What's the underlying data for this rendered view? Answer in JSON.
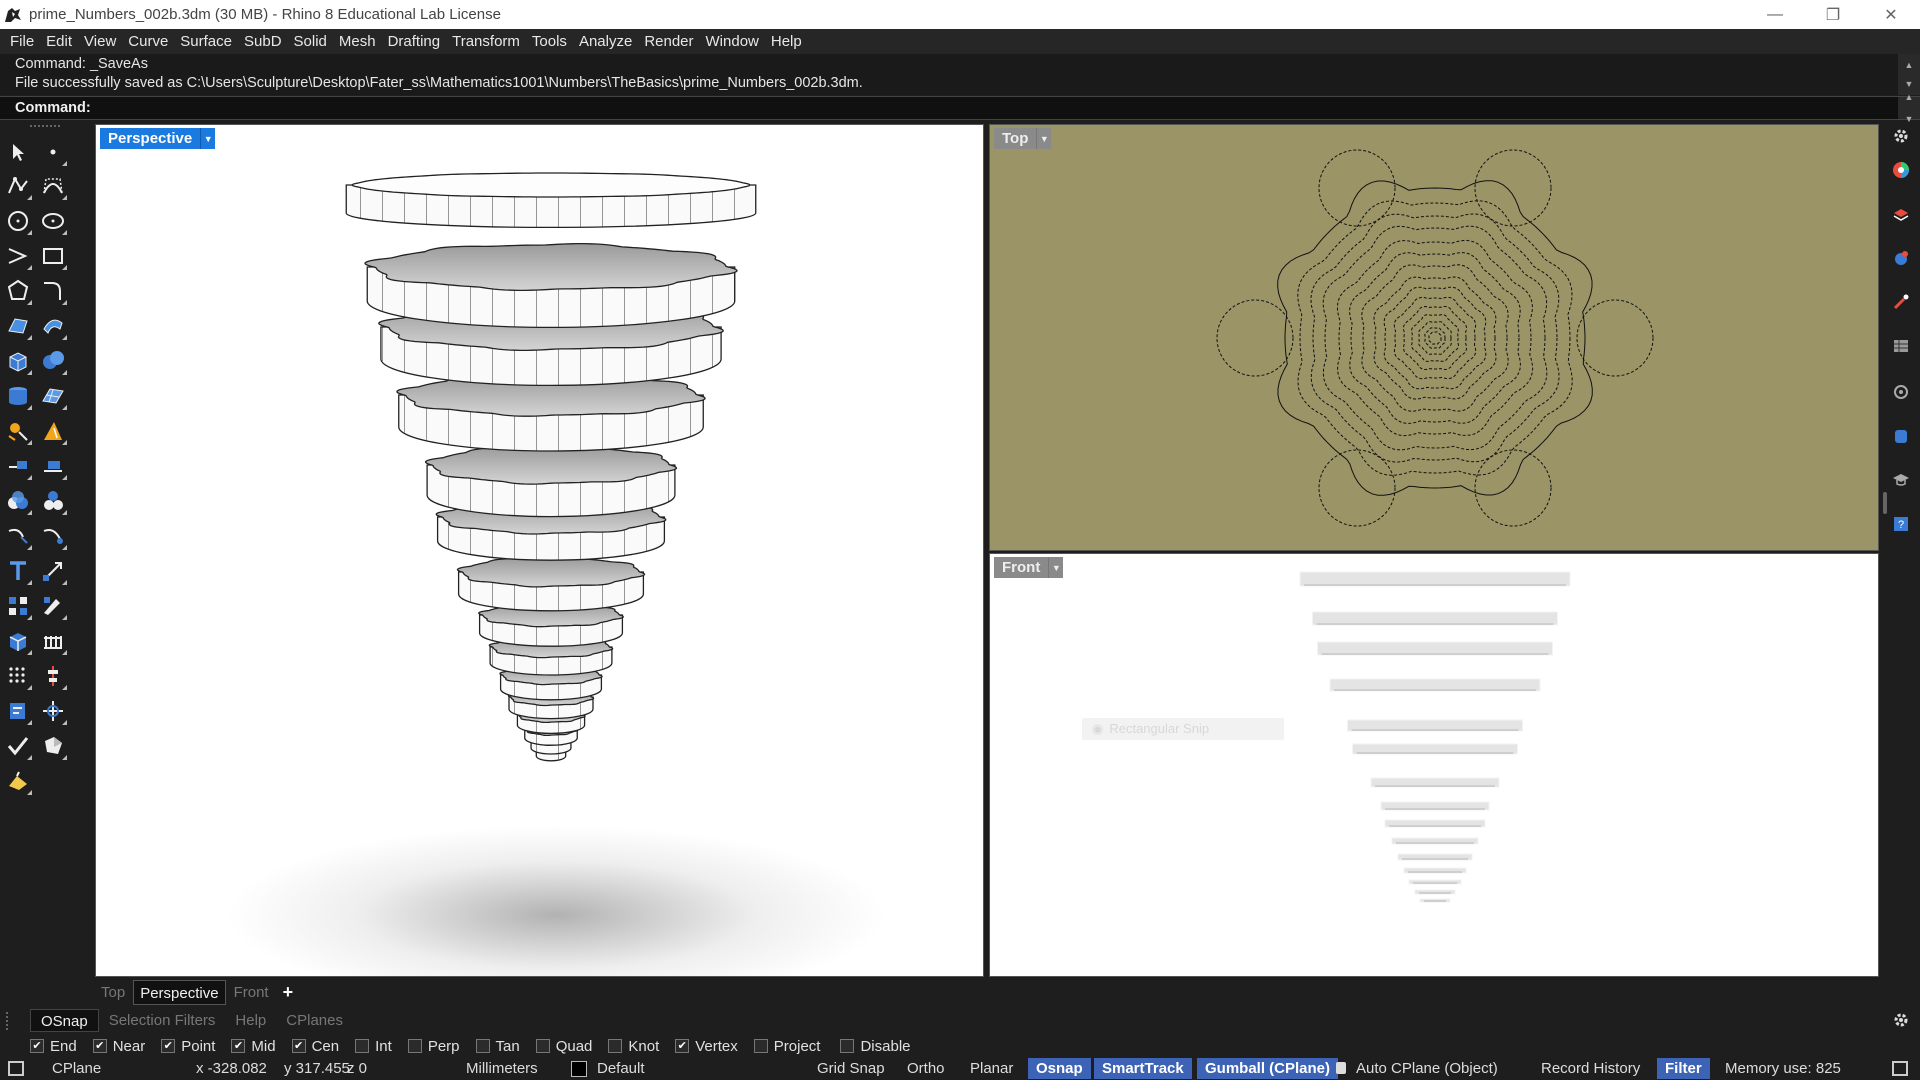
{
  "window": {
    "title": "prime_Numbers_002b.3dm (30 MB) - Rhino 8 Educational Lab License",
    "controls": [
      "minimize",
      "restore",
      "close"
    ]
  },
  "menu": [
    "File",
    "Edit",
    "View",
    "Curve",
    "Surface",
    "SubD",
    "Solid",
    "Mesh",
    "Drafting",
    "Transform",
    "Tools",
    "Analyze",
    "Render",
    "Window",
    "Help"
  ],
  "command_history": [
    "Command: _SaveAs",
    "File successfully saved as C:\\Users\\Sculpture\\Desktop\\Fater_ss\\Mathematics1001\\Numbers\\TheBasics\\prime_Numbers_002b.3dm."
  ],
  "command_prompt": "Command:",
  "viewports": {
    "perspective": {
      "label": "Perspective",
      "active": true
    },
    "top": {
      "label": "Top"
    },
    "front": {
      "label": "Front",
      "overlay_text": "Rectangular Snip"
    }
  },
  "viewport_tabs": [
    "Top",
    "Perspective",
    "Front",
    "+"
  ],
  "viewport_tab_active": "Perspective",
  "panel_tabs": [
    "OSnap",
    "Selection Filters",
    "Help",
    "CPlanes"
  ],
  "panel_tab_active": "OSnap",
  "osnaps": [
    {
      "label": "End",
      "checked": true
    },
    {
      "label": "Near",
      "checked": true
    },
    {
      "label": "Point",
      "checked": true
    },
    {
      "label": "Mid",
      "checked": true
    },
    {
      "label": "Cen",
      "checked": true
    },
    {
      "label": "Int",
      "checked": false
    },
    {
      "label": "Perp",
      "checked": false
    },
    {
      "label": "Tan",
      "checked": false
    },
    {
      "label": "Quad",
      "checked": false
    },
    {
      "label": "Knot",
      "checked": false
    },
    {
      "label": "Vertex",
      "checked": true
    },
    {
      "label": "Project",
      "checked": false
    },
    {
      "label": "Disable",
      "checked": false
    }
  ],
  "status": {
    "cplane": "CPlane",
    "x": "x -328.082",
    "y": "y 317.455",
    "z": "z 0",
    "units": "Millimeters",
    "layer": "Default",
    "panes": [
      {
        "label": "Grid Snap",
        "on": false
      },
      {
        "label": "Ortho",
        "on": false
      },
      {
        "label": "Planar",
        "on": false
      },
      {
        "label": "Osnap",
        "on": true
      },
      {
        "label": "SmartTrack",
        "on": true
      },
      {
        "label": "Gumball (CPlane)",
        "on": true
      },
      {
        "label": "Auto CPlane (Object)",
        "on": false
      },
      {
        "label": "Record History",
        "on": false
      },
      {
        "label": "Filter",
        "on": true
      }
    ],
    "memory": "Memory use: 825"
  },
  "colors": {
    "accent": "#1b7ae0",
    "top_viewport_bg": "#9a9467",
    "status_on": "#3c63b5"
  }
}
